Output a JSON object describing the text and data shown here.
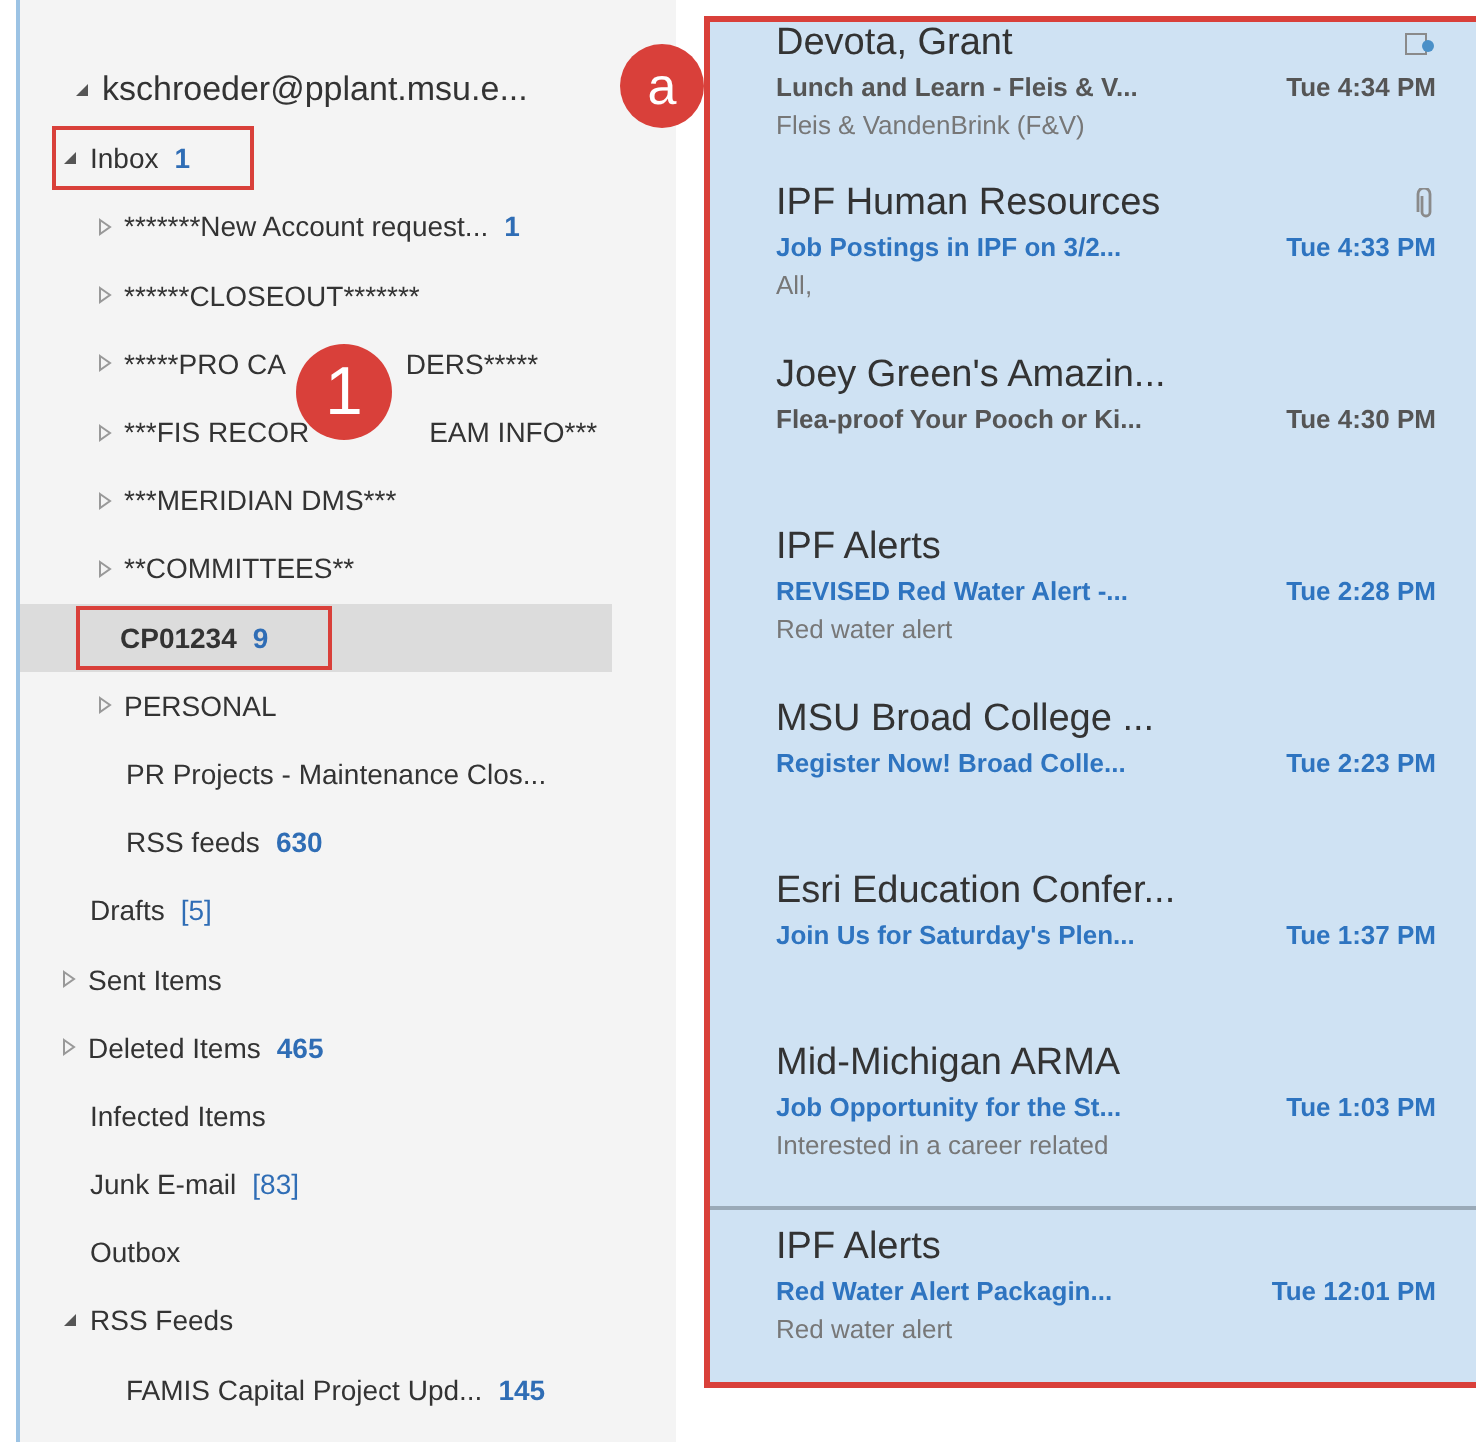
{
  "folders": [
    {
      "label": "kschroeder@pplant.msu.e...",
      "expanded": true,
      "selected": false,
      "annotated": false,
      "children": [
        {
          "label": "Inbox",
          "count": "1",
          "count_bold": true,
          "expanded": true,
          "selected": false,
          "annotated": true,
          "children": [
            {
              "label": "*******New Account request...",
              "count": "1",
              "count_bold": true,
              "expanded": false,
              "selected": false,
              "annotated": false
            },
            {
              "label": "******CLOSEOUT*******",
              "expanded": false,
              "selected": false,
              "annotated": false
            },
            {
              "label": "*****PRO CA",
              "label_after": "DERS*****",
              "expanded": false,
              "selected": false,
              "annotated": false
            },
            {
              "label": "***FIS RECOR",
              "label_after": "EAM INFO***",
              "expanded": false,
              "selected": false,
              "annotated": false
            },
            {
              "label": "***MERIDIAN DMS***",
              "expanded": false,
              "selected": false,
              "annotated": false
            },
            {
              "label": "**COMMITTEES**",
              "expanded": false,
              "selected": false,
              "annotated": false
            },
            {
              "label": "CP01234",
              "count": "9",
              "count_bold": true,
              "selected": true,
              "annotated": true
            },
            {
              "label": "PERSONAL",
              "expanded": false,
              "selected": false,
              "annotated": false
            },
            {
              "label": "PR Projects - Maintenance Clos...",
              "selected": false,
              "annotated": false
            },
            {
              "label": "RSS feeds",
              "count": "630",
              "count_bold": true,
              "selected": false,
              "annotated": false
            }
          ]
        },
        {
          "label": "Drafts",
          "count": "[5]",
          "count_bold": false,
          "selected": false,
          "annotated": false
        },
        {
          "label": "Sent Items",
          "expanded": false,
          "selected": false,
          "annotated": false
        },
        {
          "label": "Deleted Items",
          "count": "465",
          "count_bold": true,
          "expanded": false,
          "selected": false,
          "annotated": false
        },
        {
          "label": "Infected Items",
          "selected": false,
          "annotated": false
        },
        {
          "label": "Junk E-mail",
          "count": "[83]",
          "count_bold": false,
          "selected": false,
          "annotated": false
        },
        {
          "label": "Outbox",
          "selected": false,
          "annotated": false
        },
        {
          "label": "RSS Feeds",
          "expanded": true,
          "selected": false,
          "annotated": false,
          "children": [
            {
              "label": "FAMIS Capital Project Upd...",
              "count": "145",
              "count_bold": true,
              "selected": false,
              "annotated": false
            }
          ]
        }
      ]
    }
  ],
  "messages": [
    {
      "sender": "Devota, Grant",
      "subject": "Lunch and Learn - Fleis & V...",
      "time": "Tue 4:34 PM",
      "preview": "Fleis & VandenBrink (F&V)",
      "unread": false,
      "meeting": true
    },
    {
      "sender": "IPF Human Resources",
      "subject": "Job Postings in IPF on 3/2...",
      "time": "Tue 4:33 PM",
      "preview": "All,",
      "unread": true,
      "attachment": true
    },
    {
      "sender": "Joey Green's Amazin...",
      "subject": "Flea-proof Your Pooch or Ki...",
      "time": "Tue 4:30 PM",
      "unread": false
    },
    {
      "sender": "IPF Alerts",
      "subject": "REVISED Red Water Alert -...",
      "time": "Tue 2:28 PM",
      "preview": "Red water alert",
      "unread": true
    },
    {
      "sender": "MSU Broad College ...",
      "subject": "Register Now! Broad Colle...",
      "time": "Tue 2:23 PM",
      "unread": true
    },
    {
      "sender": "Esri Education Confer...",
      "subject": "Join Us for Saturday's Plen...",
      "time": "Tue 1:37 PM",
      "unread": true
    },
    {
      "sender": "Mid-Michigan ARMA",
      "subject": "Job Opportunity for the St...",
      "time": "Tue 1:03 PM",
      "preview": "Interested in a career related",
      "unread": true
    },
    {
      "sender": "IPF Alerts",
      "subject": "Red Water Alert  Packagin...",
      "time": "Tue 12:01 PM",
      "preview": "Red water alert",
      "unread": true
    }
  ],
  "callouts": [
    {
      "label": "a"
    },
    {
      "label": "1"
    }
  ]
}
